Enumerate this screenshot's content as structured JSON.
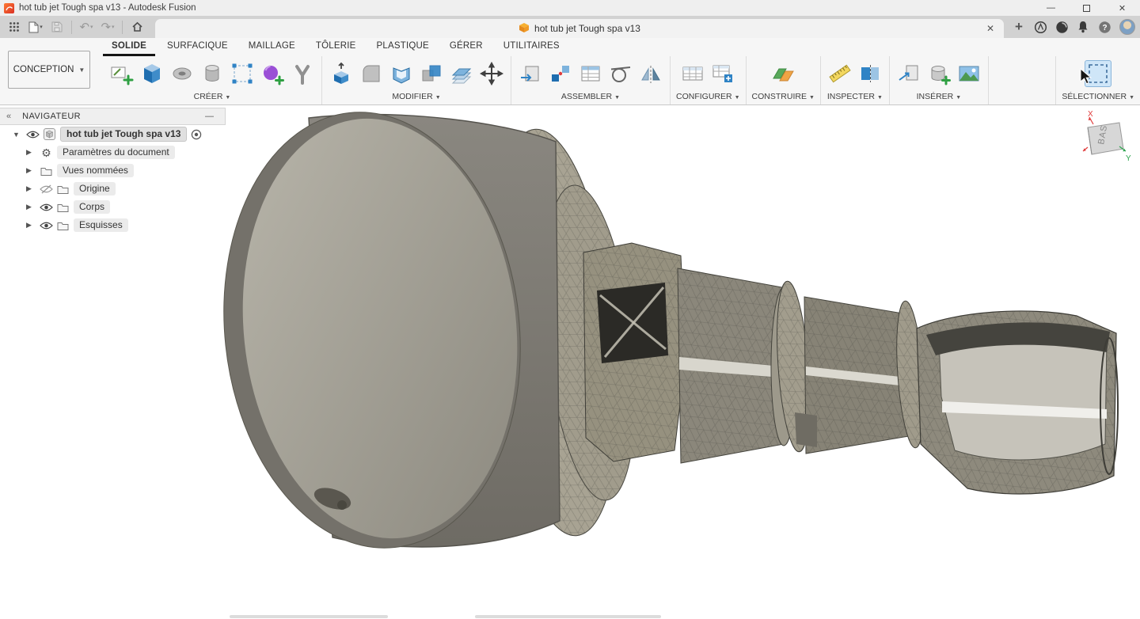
{
  "window": {
    "title": "hot tub jet Tough spa v13 - Autodesk Fusion",
    "controls": [
      "minimize-icon",
      "maximize-icon",
      "close-icon"
    ]
  },
  "appbar": {
    "document_tab_label": "hot tub jet Tough spa v13",
    "left_icons": [
      "app-grid-icon",
      "file-menu-icon",
      "save-icon",
      "undo-icon",
      "redo-icon",
      "home-icon"
    ],
    "right_icons": [
      "new-tab-icon",
      "extensions-icon",
      "job-status-icon",
      "notifications-icon",
      "help-icon",
      "user-avatar"
    ]
  },
  "ribbon": {
    "workspace_label": "CONCEPTION",
    "active_tab": "SOLIDE",
    "tabs": [
      "SOLIDE",
      "SURFACIQUE",
      "MAILLAGE",
      "TÔLERIE",
      "PLASTIQUE",
      "GÉRER",
      "UTILITAIRES"
    ],
    "groups": [
      {
        "label": "CRÉER",
        "icons": [
          "create-sketch-icon",
          "extrude-icon",
          "revolve-icon",
          "cylinder-icon",
          "pattern-box-icon",
          "create-form-icon",
          "sweep-icon"
        ]
      },
      {
        "label": "MODIFIER",
        "icons": [
          "press-pull-icon",
          "fillet-icon",
          "shell-icon",
          "combine-icon",
          "offset-face-icon",
          "move-icon"
        ]
      },
      {
        "label": "ASSEMBLER",
        "icons": [
          "new-component-icon",
          "joint-icon",
          "joint-list-icon",
          "tangent-relation-icon",
          "mirror-icon"
        ]
      },
      {
        "label": "CONFIGURER",
        "icons": [
          "configuration-table-icon",
          "configuration-insert-icon"
        ]
      },
      {
        "label": "CONSTRUIRE",
        "icons": [
          "construction-plane-icon"
        ]
      },
      {
        "label": "INSPECTER",
        "icons": [
          "measure-icon",
          "section-analysis-icon"
        ]
      },
      {
        "label": "INSÉRER",
        "icons": [
          "insert-derive-icon",
          "insert-mesh-icon",
          "insert-image-icon"
        ]
      },
      {
        "label": "SÉLECTIONNER",
        "icons": [
          "select-icon"
        ],
        "highlighted": true
      }
    ]
  },
  "navigator": {
    "title": "NAVIGATEUR",
    "items": [
      {
        "label": "hot tub jet Tough spa v13",
        "icon": "component-icon",
        "visible": true,
        "selected": true,
        "expanded": true
      },
      {
        "label": "Paramètres du document",
        "icon": "settings-gear-icon"
      },
      {
        "label": "Vues nommées",
        "icon": "folder-icon"
      },
      {
        "label": "Origine",
        "icon": "folder-icon",
        "visible": false
      },
      {
        "label": "Corps",
        "icon": "folder-icon",
        "visible": true
      },
      {
        "label": "Esquisses",
        "icon": "folder-icon",
        "visible": true
      }
    ]
  },
  "viewcube": {
    "face_label": "BAS",
    "axis_x_label": "X",
    "axis_y_label": "Y"
  },
  "colors": {
    "accent_blue": "#1f6eb0",
    "selection_highlight": "#cfe6f8",
    "active_tab_underline": "#151515",
    "fusion_orange": "#f0562d",
    "axis_x_red": "#e03c3c",
    "axis_y_green": "#2ea44f"
  }
}
